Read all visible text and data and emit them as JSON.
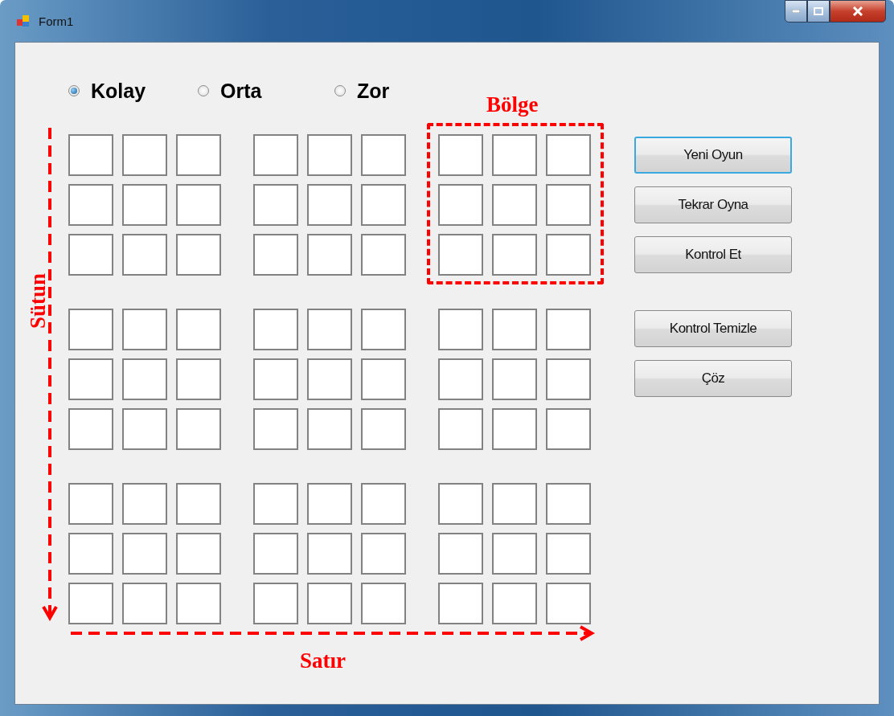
{
  "window": {
    "title": "Form1"
  },
  "difficulty": [
    {
      "label": "Kolay",
      "selected": true
    },
    {
      "label": "Orta",
      "selected": false
    },
    {
      "label": "Zor",
      "selected": false
    }
  ],
  "button_groups": [
    {
      "buttons": [
        {
          "label": "Yeni Oyun",
          "focused": true
        },
        {
          "label": "Tekrar Oyna",
          "focused": false
        },
        {
          "label": "Kontrol Et",
          "focused": false
        }
      ]
    },
    {
      "buttons": [
        {
          "label": "Kontrol Temizle",
          "focused": false
        },
        {
          "label": "Çöz",
          "focused": false
        }
      ]
    }
  ],
  "annotations": [
    {
      "kind": "region",
      "label": "Bölge"
    },
    {
      "kind": "column",
      "label": "Sütun"
    },
    {
      "kind": "row",
      "label": "Satır"
    }
  ]
}
